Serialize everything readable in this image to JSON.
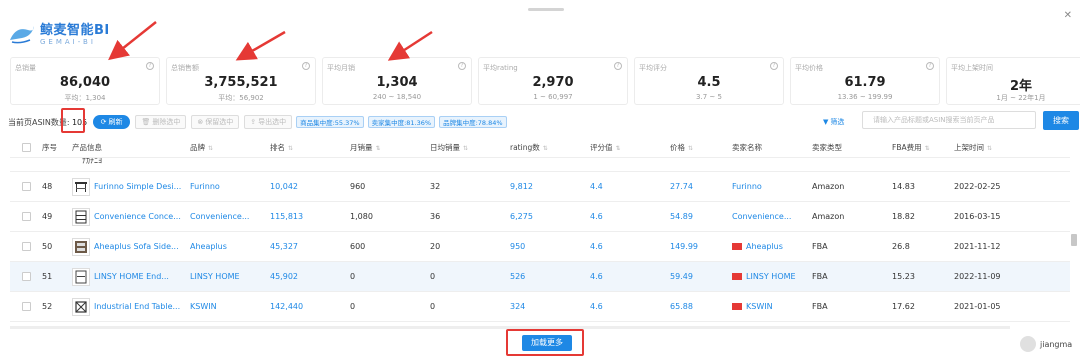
{
  "brand": {
    "name": "鲸麦智能",
    "suffix": "BI",
    "sub": "GEMAI-BI"
  },
  "accent": "#1e88e5",
  "annotation_color": "#e53935",
  "stats": [
    {
      "label": "总销量",
      "value": "86,040",
      "sub": "平均：1,304"
    },
    {
      "label": "总销售额",
      "value": "3,755,521",
      "sub": "平均：56,902"
    },
    {
      "label": "平均月销",
      "value": "1,304",
      "sub": "240 ~ 18,540"
    },
    {
      "label": "平均rating",
      "value": "2,970",
      "sub": "1 ~ 60,997"
    },
    {
      "label": "平均评分",
      "value": "4.5",
      "sub": "3.7 ~ 5"
    },
    {
      "label": "平均价格",
      "value": "61.79",
      "sub": "13.36 ~ 199.99"
    },
    {
      "label": "平均上架时间",
      "value": "2年",
      "sub": "1月 ~ 22年1月"
    }
  ],
  "toolbar": {
    "page_label": "当前页ASIN数量:",
    "count": "105",
    "refresh": "刷新",
    "delete_selected": "删除选中",
    "keep_selected": "保留选中",
    "export_selected": "导出选中",
    "tags": [
      "商品集中度:55.37%",
      "卖家集中度:81.36%",
      "品牌集中度:78.84%"
    ],
    "filter": "筛选",
    "search_placeholder": "请输入产品标题或ASIN搜索当前页产品",
    "search": "搜索"
  },
  "columns": [
    "序号",
    "产品信息",
    "品牌",
    "排名",
    "月销量",
    "日均销量",
    "rating数",
    "评分值",
    "价格",
    "卖家名称",
    "卖家类型",
    "FBA费用",
    "上架时间"
  ],
  "partial_row_text": "ﾅｶﾁﾆﾖ",
  "rows": [
    {
      "idx": "48",
      "product": "Furinno Simple Desi...",
      "brand": "Furinno",
      "rank": "10,042",
      "monthly": "960",
      "daily": "32",
      "ratings": "9,812",
      "score": "4.4",
      "price": "27.74",
      "seller": "Furinno",
      "flag": false,
      "type": "Amazon",
      "fba": "14.83",
      "date": "2022-02-25"
    },
    {
      "idx": "49",
      "product": "Convenience Conce...",
      "brand": "Convenience...",
      "rank": "115,813",
      "monthly": "1,080",
      "daily": "36",
      "ratings": "6,275",
      "score": "4.6",
      "price": "54.89",
      "seller": "Convenience...",
      "flag": false,
      "type": "Amazon",
      "fba": "18.82",
      "date": "2016-03-15"
    },
    {
      "idx": "50",
      "product": "Aheaplus Sofa Side...",
      "brand": "Aheaplus",
      "rank": "45,327",
      "monthly": "600",
      "daily": "20",
      "ratings": "950",
      "score": "4.6",
      "price": "149.99",
      "seller": "Aheaplus",
      "flag": true,
      "type": "FBA",
      "fba": "26.8",
      "date": "2021-11-12"
    },
    {
      "idx": "51",
      "product": "LINSY HOME End...",
      "brand": "LINSY HOME",
      "rank": "45,902",
      "monthly": "0",
      "daily": "0",
      "ratings": "526",
      "score": "4.6",
      "price": "59.49",
      "seller": "LINSY HOME",
      "flag": true,
      "type": "FBA",
      "fba": "15.23",
      "date": "2022-11-09"
    },
    {
      "idx": "52",
      "product": "Industrial End Table...",
      "brand": "KSWIN",
      "rank": "142,440",
      "monthly": "0",
      "daily": "0",
      "ratings": "324",
      "score": "4.6",
      "price": "65.88",
      "seller": "KSWIN",
      "flag": true,
      "type": "FBA",
      "fba": "17.62",
      "date": "2021-01-05"
    }
  ],
  "load_more": "加载更多",
  "user": "jiangma"
}
